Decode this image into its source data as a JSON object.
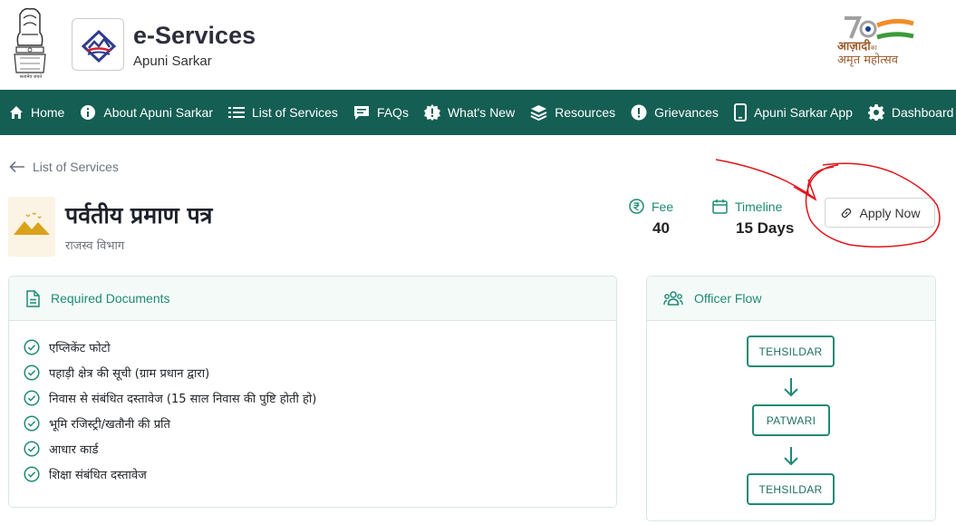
{
  "header": {
    "emblem_motto": "सत्यमेव जयते",
    "brand_title": "e-Services",
    "brand_subtitle": "Apuni Sarkar",
    "azadi_line1": "आज़ादी",
    "azadi_line1_small": "का",
    "azadi_line2": "अमृत महोत्सव"
  },
  "nav": {
    "items": [
      {
        "label": "Home",
        "icon": "home-icon"
      },
      {
        "label": "About Apuni Sarkar",
        "icon": "info-icon"
      },
      {
        "label": "List of Services",
        "icon": "list-icon"
      },
      {
        "label": "FAQs",
        "icon": "chat-icon"
      },
      {
        "label": "What's New",
        "icon": "badge-alert-icon"
      },
      {
        "label": "Resources",
        "icon": "layers-icon"
      },
      {
        "label": "Grievances",
        "icon": "alert-icon"
      },
      {
        "label": "Apuni Sarkar App",
        "icon": "mobile-icon"
      },
      {
        "label": "Dashboard",
        "icon": "gear-icon"
      }
    ],
    "background": "#155e53"
  },
  "breadcrumb": {
    "back_label": "List of Services"
  },
  "service": {
    "title": "पर्वतीय प्रमाण पत्र",
    "department": "राजस्व विभाग",
    "fee_label": "Fee",
    "fee_value": "​40",
    "timeline_label": "Timeline",
    "timeline_value": "15 Days",
    "apply_label": "Apply Now"
  },
  "required_documents": {
    "title": "Required Documents",
    "items": [
      "एप्लिकेंट फोटो",
      "पहाड़ी क्षेत्र की सूची (ग्राम प्रधान द्वारा)",
      "निवास से संबंधित दस्तावेज (15 साल निवास की पुष्टि होती हो)",
      "भूमि रजिस्ट्री/खतौनी की प्रति",
      "आधार कार्ड",
      "शिक्षा संबंधित दस्तावेज"
    ]
  },
  "officer_flow": {
    "title": "Officer Flow",
    "steps": [
      "TEHSILDAR",
      "PATWARI",
      "TEHSILDAR"
    ]
  },
  "colors": {
    "accent": "#1f8a74",
    "nav": "#155e53",
    "annotation": "#e0131a"
  }
}
